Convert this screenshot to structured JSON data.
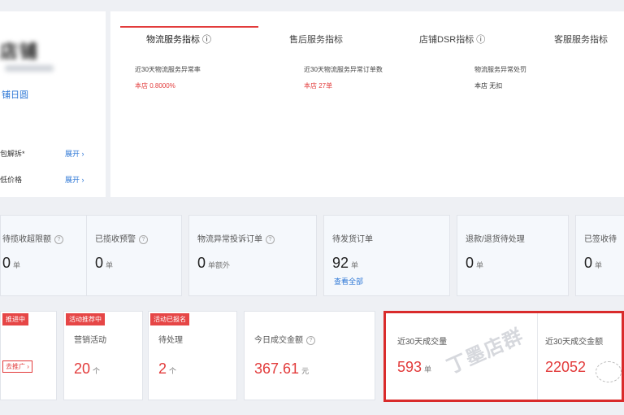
{
  "left": {
    "link": "铺日圆",
    "rows": [
      {
        "label": "包解拆*",
        "value": "展开 ›"
      },
      {
        "label": "低价格",
        "value": "展开 ›"
      }
    ]
  },
  "tabs": {
    "items": [
      "物流服务指标 ⓘ",
      "售后服务指标",
      "店铺DSR指标 ⓘ",
      "客服服务指标"
    ],
    "metrics": [
      {
        "title": "近30天物流服务异常率",
        "value": "本店 0.8000%"
      },
      {
        "title": "近30天物流服务异常订单数",
        "value": "本店 27单"
      },
      {
        "title": "物流服务异常处罚",
        "value": "本店 无扣"
      }
    ]
  },
  "mid_cards": [
    {
      "title": "待揽收超限额",
      "value": "0",
      "unit": "单"
    },
    {
      "title": "已揽收预警",
      "value": "0",
      "unit": "单"
    },
    {
      "title": "物流异常投诉订单",
      "value": "0",
      "unit": "单额外"
    },
    {
      "title": "待发货订单",
      "value": "92",
      "unit": "单",
      "link": "查看全部"
    },
    {
      "title": "退款/退货待处理",
      "value": "0",
      "unit": "单"
    },
    {
      "title": "已签收待",
      "value": "0",
      "unit": "单"
    }
  ],
  "bottom_cards": [
    {
      "tag": "推进中",
      "title": "",
      "value": "",
      "button": "去推广 ›"
    },
    {
      "tag": "活动推荐中",
      "title": "营销活动",
      "value": "20",
      "unit": "个"
    },
    {
      "tag": "活动已报名",
      "title": "待处理",
      "value": "2",
      "unit": "个"
    },
    {
      "title": "今日成交金额",
      "value": "367.61",
      "unit": "元"
    },
    {
      "title": "近30天成交量",
      "value": "593",
      "unit": "单"
    },
    {
      "title": "近30天成交金额",
      "value": "22052",
      "unit": "元"
    }
  ],
  "watermark": "丁墨店群"
}
